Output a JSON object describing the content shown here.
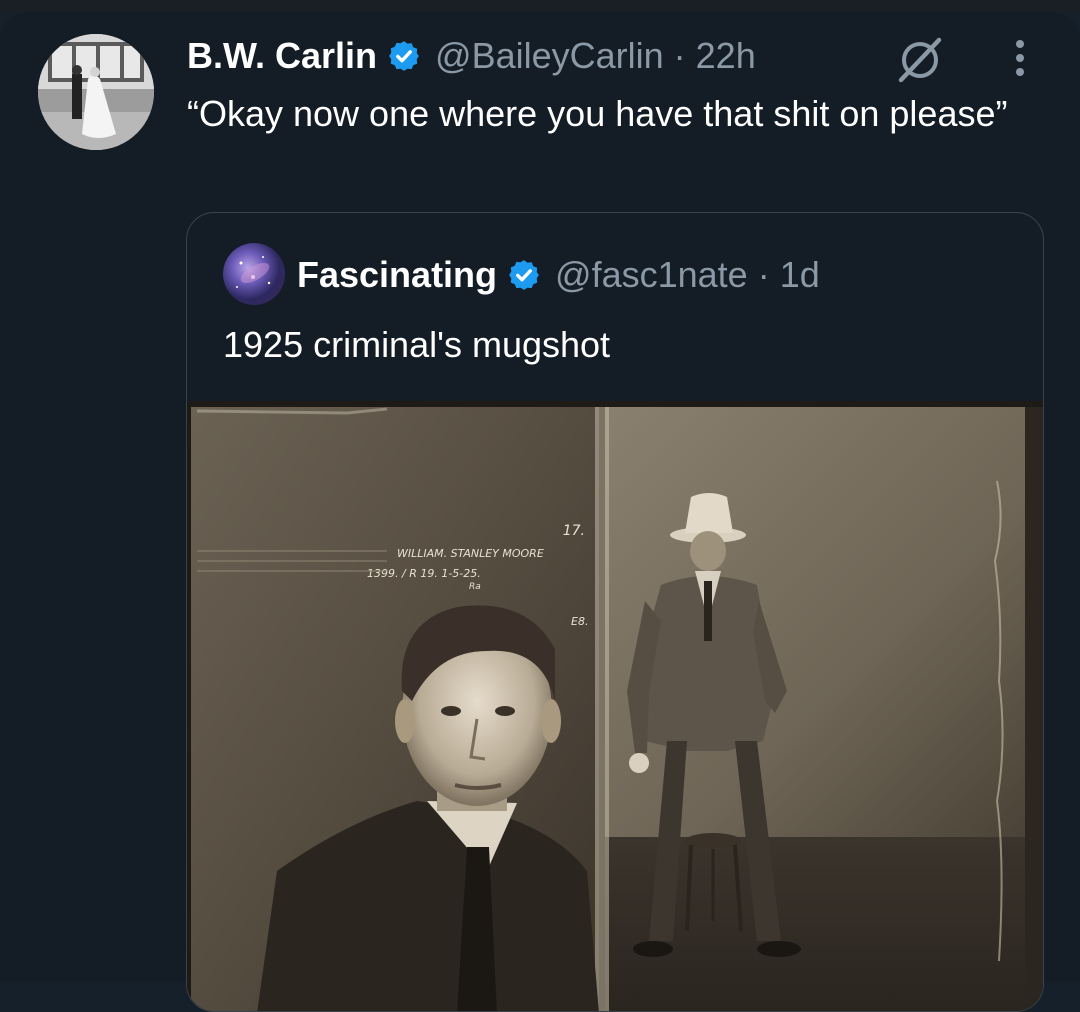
{
  "tweet": {
    "display_name": "B.W. Carlin",
    "handle_time": "@BaileyCarlin · 22h",
    "text": "“Okay now one where you have that shit on please”",
    "avatar_icon": "wedding-photo-avatar",
    "verified_icon": "verified-badge-icon",
    "grok_icon": "grok-icon",
    "more_icon": "more-vertical-icon"
  },
  "quote": {
    "display_name": "Fascinating",
    "handle_time": "@fasc1nate · 1d",
    "text": "1925 criminal's mugshot",
    "avatar_icon": "galaxy-avatar",
    "verified_icon": "verified-badge-icon",
    "photo": {
      "caption_line1": "WILLIAM. STANLEY MOORE",
      "caption_line2": "1399. / R 19. 1-5-25.",
      "caption_line3": "Ra",
      "caption_number": "17.",
      "caption_code": "E8."
    }
  },
  "colors": {
    "background": "#141d26",
    "text_primary": "#ffffff",
    "text_secondary": "#8b98a5",
    "verified_blue": "#1d9bf0",
    "border": "#38444d"
  }
}
